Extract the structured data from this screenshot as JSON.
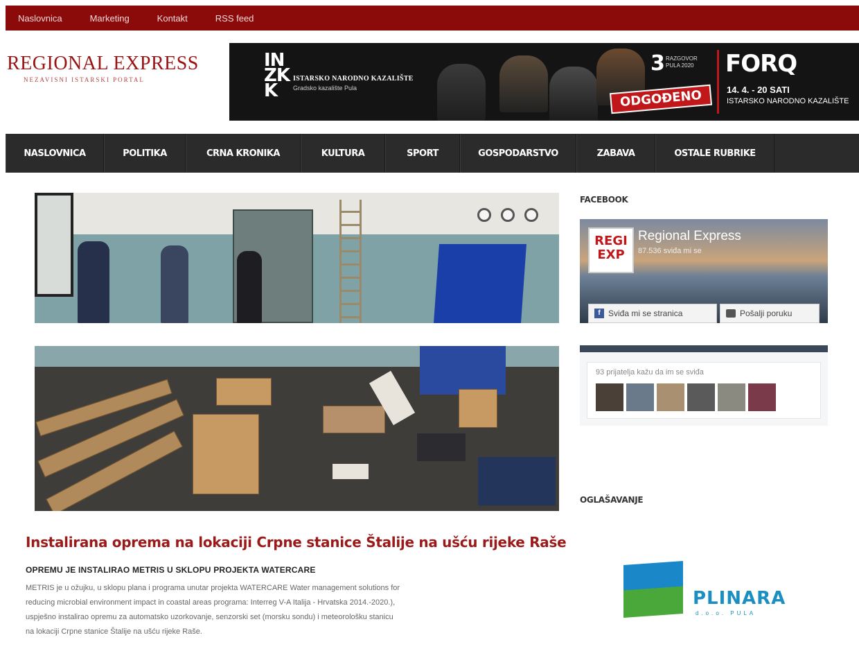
{
  "topbar": {
    "links": [
      "Naslovnica",
      "Marketing",
      "Kontakt",
      "RSS feed"
    ]
  },
  "logo": {
    "title": "REGIONAL EXPRESS",
    "subtitle": "NEZAVISNI ISTARSKI PORTAL"
  },
  "banner": {
    "badge": "INZK",
    "theatre": "ISTARSKO NARODNO KAZALIŠTE",
    "theatre_sub": "Gradsko kazalište Pula",
    "count": "3",
    "count_note": "RAZGOVOR PULA 2020",
    "stamp": "ODGOĐENO",
    "band": "FORQ",
    "date": "14. 4. - 20 SATI",
    "venue": "ISTARSKO NARODNO KAZALIŠTE"
  },
  "nav": {
    "items": [
      "NASLOVNICA",
      "POLITIKA",
      "CRNA KRONIKA",
      "KULTURA",
      "SPORT",
      "GOSPODARSTVO",
      "ZABAVA",
      "OSTALE RUBRIKE"
    ]
  },
  "article": {
    "title": "Instalirana oprema na lokaciji Crpne stanice Štalije na ušću rijeke Raše",
    "subtitle": "OPREMU JE INSTALIRAO METRIS U SKLOPU PROJEKTA WATERCARE",
    "body_lines": [
      "METRIS je u ožujku, u sklopu plana i programa unutar projekta WATERCARE Water management solutions for",
      "reducing microbial environment impact in coastal areas programa: Interreg V-A Italija - Hrvatska 2014.-2020.),",
      "uspješno instalirao opremu za automatsko uzorkovanje, senzorski set (morsku sondu) i meteorološku stanicu",
      "na lokaciji Crpne stanice Štalije na ušću rijeke Raše."
    ]
  },
  "sidebar": {
    "facebook_heading": "FACEBOOK",
    "fb_page_name": "Regional Express",
    "fb_likes": "87.536 sviđa mi se",
    "fb_like_button": "Sviđa mi se stranica",
    "fb_message_button": "Pošalji poruku",
    "fb_friends": "93 prijatelja kažu da im se sviđa",
    "fb_logo_text": "REGI EXP",
    "ads_heading": "OGLAŠAVANJE",
    "ad_brand": "PLINARA",
    "ad_sub": "d.o.o. PULA"
  },
  "colors": {
    "brand_red": "#8b0a0a",
    "title_red": "#9a1a1a",
    "nav_bg": "#2b2b2b"
  }
}
